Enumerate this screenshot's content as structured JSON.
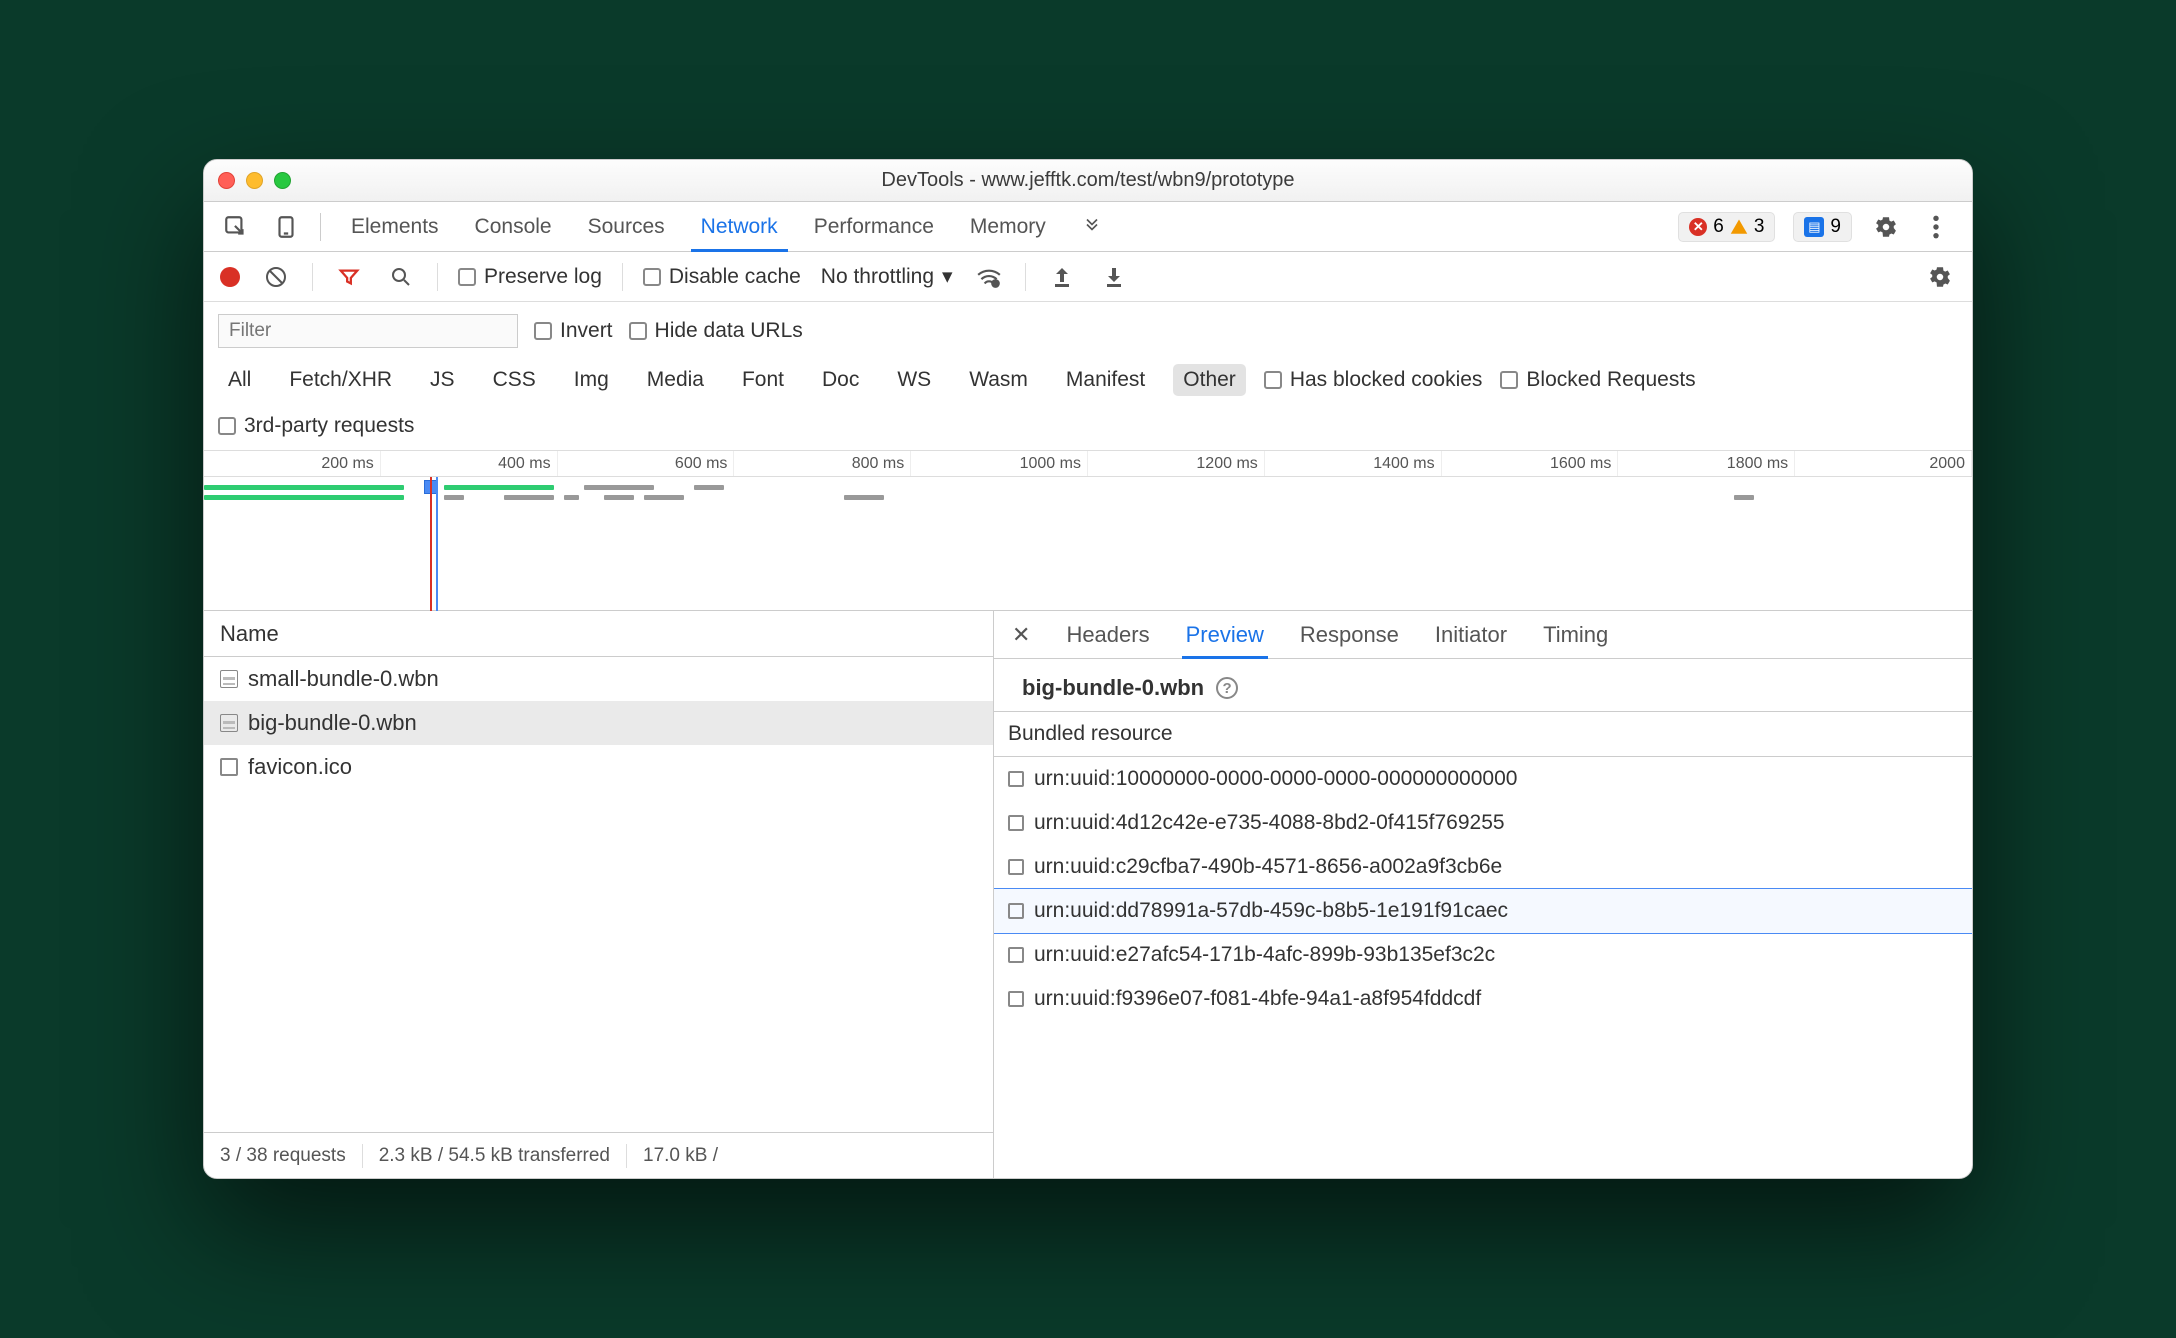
{
  "window": {
    "title": "DevTools - www.jefftk.com/test/wbn9/prototype"
  },
  "tabs": {
    "items": [
      "Elements",
      "Console",
      "Sources",
      "Network",
      "Performance",
      "Memory"
    ],
    "active": "Network",
    "errors": "6",
    "warnings": "3",
    "messages": "9"
  },
  "toolbar": {
    "preserve_log": "Preserve log",
    "disable_cache": "Disable cache",
    "throttling": "No throttling"
  },
  "filter": {
    "placeholder": "Filter",
    "invert": "Invert",
    "hide_urls": "Hide data URLs",
    "types": [
      "All",
      "Fetch/XHR",
      "JS",
      "CSS",
      "Img",
      "Media",
      "Font",
      "Doc",
      "WS",
      "Wasm",
      "Manifest",
      "Other"
    ],
    "active_type": "Other",
    "has_blocked": "Has blocked cookies",
    "blocked_req": "Blocked Requests",
    "third_party": "3rd-party requests"
  },
  "timeline": {
    "ticks": [
      "200 ms",
      "400 ms",
      "600 ms",
      "800 ms",
      "1000 ms",
      "1200 ms",
      "1400 ms",
      "1600 ms",
      "1800 ms",
      "2000 "
    ]
  },
  "name_col": "Name",
  "requests": [
    {
      "name": "small-bundle-0.wbn",
      "icon": "doc",
      "selected": false
    },
    {
      "name": "big-bundle-0.wbn",
      "icon": "doc",
      "selected": true
    },
    {
      "name": "favicon.ico",
      "icon": "box",
      "selected": false
    }
  ],
  "status_bar": {
    "requests": "3 / 38 requests",
    "transferred": "2.3 kB / 54.5 kB transferred",
    "resources": "17.0 kB /"
  },
  "detail_tabs": {
    "items": [
      "Headers",
      "Preview",
      "Response",
      "Initiator",
      "Timing"
    ],
    "active": "Preview"
  },
  "preview": {
    "title": "big-bundle-0.wbn",
    "section": "Bundled resource",
    "resources": [
      "urn:uuid:10000000-0000-0000-0000-000000000000",
      "urn:uuid:4d12c42e-e735-4088-8bd2-0f415f769255",
      "urn:uuid:c29cfba7-490b-4571-8656-a002a9f3cb6e",
      "urn:uuid:dd78991a-57db-459c-b8b5-1e191f91caec",
      "urn:uuid:e27afc54-171b-4afc-899b-93b135ef3c2c",
      "urn:uuid:f9396e07-f081-4bfe-94a1-a8f954fddcdf"
    ],
    "selected_index": 3
  }
}
